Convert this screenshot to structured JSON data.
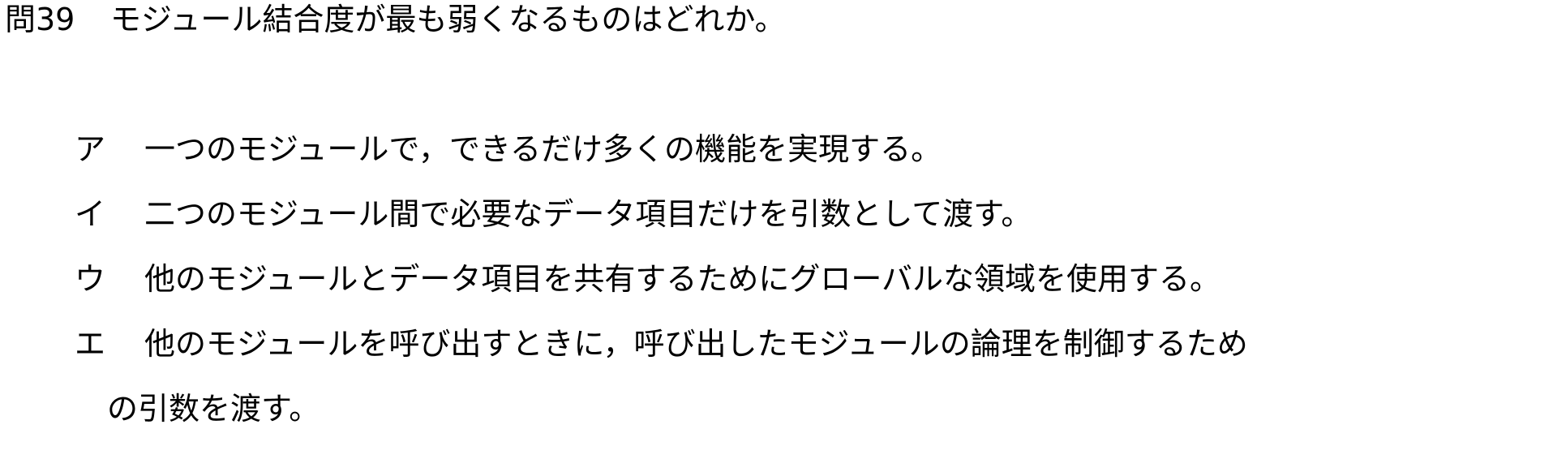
{
  "question": {
    "number": "問39",
    "text": "モジュール結合度が最も弱くなるものはどれか。"
  },
  "choices": [
    {
      "label": "ア",
      "text": "一つのモジュールで，できるだけ多くの機能を実現する。"
    },
    {
      "label": "イ",
      "text": "二つのモジュール間で必要なデータ項目だけを引数として渡す。"
    },
    {
      "label": "ウ",
      "text": "他のモジュールとデータ項目を共有するためにグローバルな領域を使用する。"
    },
    {
      "label": "エ",
      "text": "他のモジュールを呼び出すときに，呼び出したモジュールの論理を制御するため",
      "continuation": "の引数を渡す。"
    }
  ]
}
